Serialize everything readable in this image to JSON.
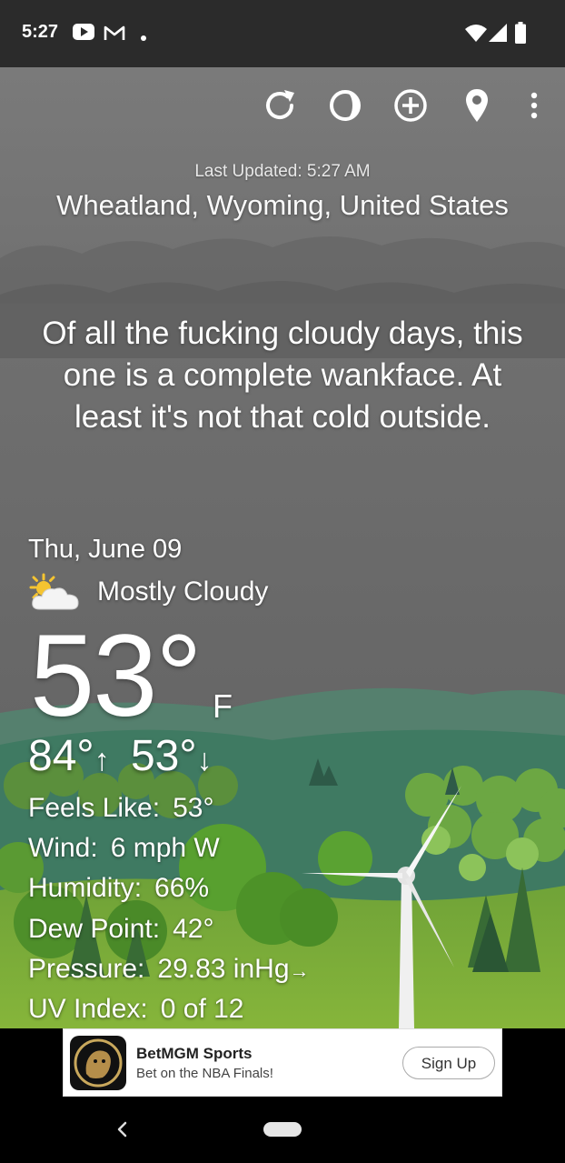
{
  "status_bar": {
    "time": "5:27",
    "left_icons": [
      "youtube-icon",
      "gmail-icon",
      "notification-dot-icon"
    ],
    "right_icons": [
      "wifi-icon",
      "signal-icon",
      "battery-icon"
    ]
  },
  "toolbar": {
    "icons": [
      "refresh-icon",
      "theme-icon",
      "add-location-icon",
      "location-pin-icon",
      "overflow-menu-icon"
    ]
  },
  "header": {
    "last_updated": "Last Updated: 5:27 AM",
    "location": "Wheatland, Wyoming, United States"
  },
  "headline": "Of all the fucking cloudy days, this one is a complete wankface. At least it's not that cold outside.",
  "current": {
    "date": "Thu, June 09",
    "condition": "Mostly Cloudy",
    "condition_icon": "partly-cloudy-icon",
    "temp": "53°",
    "unit": "F",
    "high": "84°",
    "high_arrow": "↑",
    "low": "53°",
    "low_arrow": "↓"
  },
  "details": {
    "feels_like_label": "Feels Like:",
    "feels_like": "53°",
    "wind_label": "Wind:",
    "wind": "6 mph W",
    "humidity_label": "Humidity:",
    "humidity": "66%",
    "dew_point_label": "Dew Point:",
    "dew_point": "42°",
    "pressure_label": "Pressure:",
    "pressure": "29.83 inHg",
    "pressure_trend": "→",
    "uv_label": "UV Index:",
    "uv": "0 of 12"
  },
  "ad": {
    "title": "BetMGM Sports",
    "subtitle": "Bet on the NBA Finals!",
    "button": "Sign Up"
  },
  "colors": {
    "sky": "#6f6f6f",
    "status_bar": "#2b2b2b",
    "grass": "#7dab38",
    "hills": "#3f7a62"
  }
}
